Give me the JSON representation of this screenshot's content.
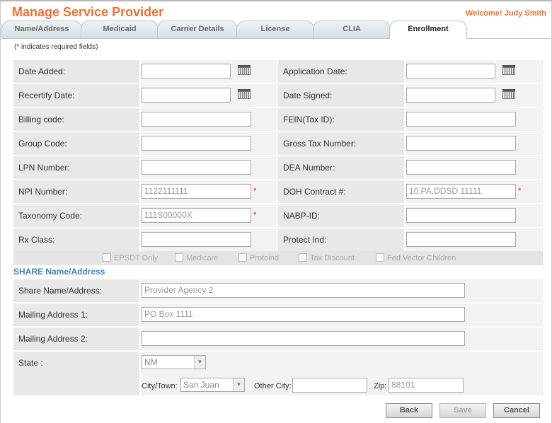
{
  "header": {
    "title": "Manage Service Provider",
    "welcome": "Welcome! Judy Smith"
  },
  "tabs": [
    {
      "label": "Name/Address",
      "active": false
    },
    {
      "label": "Medicaid",
      "active": false
    },
    {
      "label": "Carrier Details",
      "active": false
    },
    {
      "label": "License",
      "active": false
    },
    {
      "label": "CLIA",
      "active": false
    },
    {
      "label": "Enrollment",
      "active": true
    }
  ],
  "required_note": {
    "star": "*",
    "text": " indicates required fields)",
    "open": "("
  },
  "rows": [
    {
      "left_label": "Date Added:",
      "left_value": "",
      "right_label": "Application Date:",
      "right_value": ""
    },
    {
      "left_label": "Recertify Date:",
      "left_value": "",
      "right_label": "Date Signed:",
      "right_value": ""
    },
    {
      "left_label": "Billing code:",
      "left_value": "",
      "right_label": "FEIN(Tax ID):",
      "right_value": ""
    },
    {
      "left_label": "Group Code:",
      "left_value": "",
      "right_label": "Gross Tax Number:",
      "right_value": ""
    },
    {
      "left_label": "LPN Number:",
      "left_value": "",
      "right_label": "DEA Number:",
      "right_value": ""
    },
    {
      "left_label": "NPI Number:",
      "left_value": "1122111111",
      "right_label": "DOH Contract #:",
      "right_value": "10.PA.DDSD.11111"
    },
    {
      "left_label": "Taxonomy Code:",
      "left_value": "111S00000X",
      "right_label": "NABP-ID:",
      "right_value": ""
    },
    {
      "left_label": "Rx Class:",
      "left_value": "",
      "right_label": "Protect Ind:",
      "right_value": ""
    }
  ],
  "checkboxes": [
    {
      "label": "EPSDT Only",
      "checked": false
    },
    {
      "label": "Medicare",
      "checked": false
    },
    {
      "label": "Protoind",
      "checked": false
    },
    {
      "label": "Tax Discount",
      "checked": false
    },
    {
      "label": "Fed Vector Children",
      "checked": false
    }
  ],
  "share": {
    "section_title": "SHARE Name/Address",
    "name_label": "Share Name/Address:",
    "name_value": "Provider Agency 2",
    "mail1_label": "Mailing Address 1:",
    "mail1_value": "PO Box 1111",
    "mail2_label": "Mailing Address 2:",
    "mail2_value": "",
    "state_label": "State :",
    "state_value": "NM",
    "city_label": "City/Town:",
    "city_value": "San Juan",
    "other_city_label": "Other City:",
    "other_city_value": "",
    "zip_label": "Zip:",
    "zip_value": "88101"
  },
  "required_star": "*",
  "buttons": {
    "back": "Back",
    "save": "Save",
    "cancel": "Cancel"
  },
  "colors": {
    "accent": "#f07030",
    "section": "#3a84b8",
    "required": "#dd0000"
  }
}
